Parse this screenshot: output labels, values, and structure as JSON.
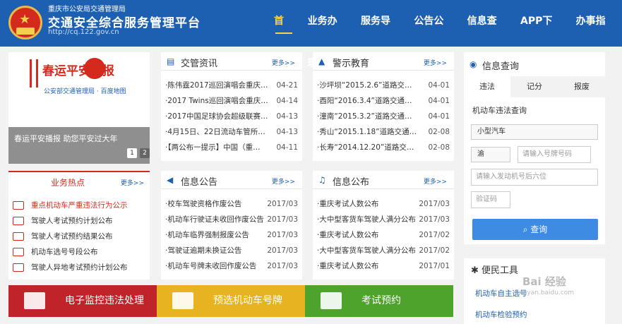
{
  "header": {
    "org": "重庆市公安局交通管理局",
    "title": "交通安全综合服务管理平台",
    "url": "http://cq.122.gov.cn",
    "nav": [
      "首页",
      "业务办理",
      "服务导航",
      "公告公布",
      "信息查询",
      "APP下载",
      "办事指南"
    ]
  },
  "banner": {
    "title": "春运平安播报",
    "logos": "公安部交通管理局 · 百度地图",
    "slide_text": "春运平安播报 助您平安过大年",
    "dot1": "1",
    "dot2": "2"
  },
  "news": {
    "title": "交管资讯",
    "more": "更多>>",
    "items": [
      {
        "t": "·陈伟霆2017巡回演唱会重庆…",
        "d": "04-21"
      },
      {
        "t": "·2017 Twins巡回演唱会重庆…",
        "d": "04-14"
      },
      {
        "t": "·2017中国足球协会超级联赛…",
        "d": "04-13"
      },
      {
        "t": "·4月15日、22日流动车管所…",
        "d": "04-13"
      },
      {
        "t": "·【两公布一提示】中国（重…",
        "d": "04-11"
      }
    ]
  },
  "warning": {
    "title": "警示教育",
    "more": "更多>>",
    "items": [
      {
        "t": "·沙坪坝“2015.2.6”道路交…",
        "d": "04-01"
      },
      {
        "t": "·酉阳“2016.3.4”道路交通…",
        "d": "04-01"
      },
      {
        "t": "·潼南“2015.3.2”道路交通…",
        "d": "04-01"
      },
      {
        "t": "·秀山“2015.1.18”道路交通…",
        "d": "02-08"
      },
      {
        "t": "·长寿“2014.12.20”道路交…",
        "d": "02-08"
      }
    ]
  },
  "hot": {
    "title": "业务热点",
    "more": "更多>>",
    "items": [
      "重点机动车严重违法行为公示",
      "驾驶人考试预约计划公布",
      "驾驶人考试预约结果公布",
      "机动车选号号段公布",
      "驾驶人异地考试预约计划公布"
    ]
  },
  "notice": {
    "title": "信息公告",
    "more": "更多>>",
    "items": [
      {
        "t": "·校车驾驶资格作废公告",
        "d": "2017/03"
      },
      {
        "t": "·机动车行驶证未收回作废公告",
        "d": "2017/03"
      },
      {
        "t": "·机动车临界强制报废公告",
        "d": "2017/03"
      },
      {
        "t": "·驾驶证逾期未换证公告",
        "d": "2017/03"
      },
      {
        "t": "·机动车号牌未收回作废公告",
        "d": "2017/03"
      }
    ]
  },
  "publish": {
    "title": "信息公布",
    "more": "更多>>",
    "items": [
      {
        "t": "·重庆考试人数公布",
        "d": "2017/03"
      },
      {
        "t": "·大中型客货车驾驶人满分公布",
        "d": "2017/03"
      },
      {
        "t": "·重庆考试人数公布",
        "d": "2017/02"
      },
      {
        "t": "·大中型客货车驾驶人满分公布",
        "d": "2017/02"
      },
      {
        "t": "·重庆考试人数公布",
        "d": "2017/01"
      }
    ]
  },
  "query": {
    "title": "信息查询",
    "tabs": [
      "违法",
      "记分",
      "报废"
    ],
    "subtitle": "机动车违法查询",
    "vehicle_type": "小型汽车",
    "region": "渝",
    "plate_placeholder": "请输入号牌号码",
    "engine_placeholder": "请输入发动机号后六位",
    "captcha_placeholder": "验证码",
    "button": "查询"
  },
  "buttons": [
    "电子监控违法处理",
    "预选机动车号牌",
    "考试预约"
  ],
  "service": {
    "title": "便民工具",
    "items": [
      "机动车自主选号",
      "机动车检验预约"
    ]
  },
  "watermark": {
    "text": "Bai 经验",
    "sub": "jingyan.baidu.com"
  }
}
